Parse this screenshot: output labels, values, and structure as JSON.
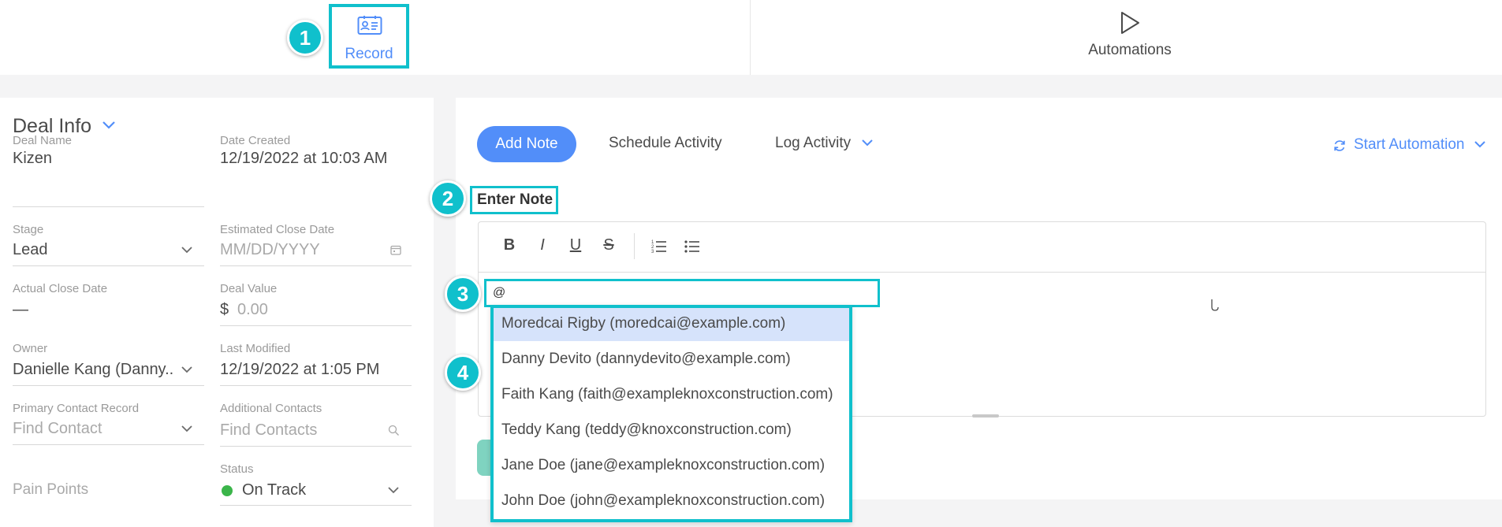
{
  "tabs": {
    "record_label": "Record",
    "automations_label": "Automations"
  },
  "badges": [
    "1",
    "2",
    "3",
    "4"
  ],
  "deal_info": {
    "title": "Deal Info",
    "fields": {
      "deal_name": {
        "label": "Deal Name",
        "value": "Kizen"
      },
      "date_created": {
        "label": "Date Created",
        "value": "12/19/2022 at 10:03 AM"
      },
      "stage": {
        "label": "Stage",
        "value": "Lead"
      },
      "estimated_close_date": {
        "label": "Estimated Close Date",
        "placeholder": "MM/DD/YYYY"
      },
      "actual_close_date": {
        "label": "Actual Close Date",
        "value": "—"
      },
      "deal_value": {
        "label": "Deal Value",
        "currency": "$",
        "placeholder": "0.00"
      },
      "owner": {
        "label": "Owner",
        "value": "Danielle Kang (Danny..."
      },
      "last_modified": {
        "label": "Last Modified",
        "value": "12/19/2022 at 1:05 PM"
      },
      "primary_contact": {
        "label": "Primary Contact Record",
        "placeholder": "Find Contact"
      },
      "additional_contacts": {
        "label": "Additional Contacts",
        "placeholder": "Find Contacts"
      },
      "pain_points": {
        "label": "Pain Points"
      },
      "status": {
        "label": "Status",
        "value": "On Track",
        "color": "#3bb54a"
      }
    }
  },
  "actions": {
    "add_note": "Add Note",
    "schedule_activity": "Schedule Activity",
    "log_activity": "Log Activity",
    "start_automation": "Start Automation"
  },
  "note": {
    "label": "Enter Note",
    "toolbar": [
      "B",
      "I",
      "U",
      "S"
    ],
    "input_value": "@"
  },
  "mention_options": [
    "Moredcai Rigby (moredcai@example.com)",
    "Danny Devito (dannydevito@example.com)",
    "Faith Kang (faith@exampleknoxconstruction.com)",
    "Teddy Kang (teddy@knoxconstruction.com)",
    "Jane Doe (jane@exampleknoxconstruction.com)",
    "John Doe (john@exampleknoxconstruction.com)"
  ],
  "colors": {
    "accent": "#528ef9",
    "highlight": "#10c0cc",
    "selected_option": "#d6e3fb"
  }
}
